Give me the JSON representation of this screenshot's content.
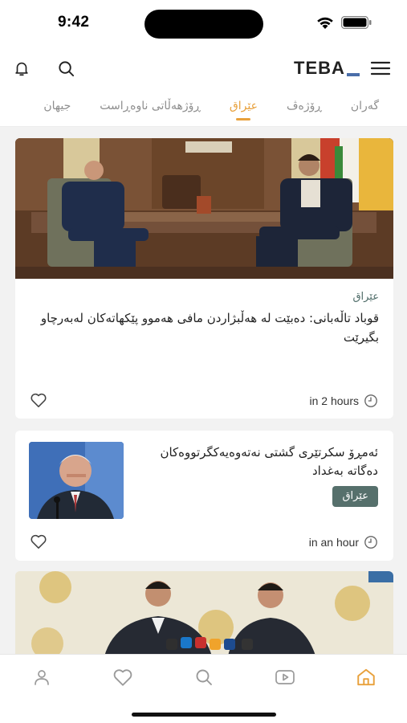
{
  "status": {
    "time": "9:42"
  },
  "header": {
    "logo_text": "TEBA",
    "bell_icon": "bell-icon",
    "search_icon": "search-icon",
    "menu_icon": "hamburger-menu-icon"
  },
  "tabs": [
    {
      "label": "گەران",
      "active": false
    },
    {
      "label": "ڕۆژەڤ",
      "active": false
    },
    {
      "label": "عێراق",
      "active": true
    },
    {
      "label": "ڕۆژهەڵاتی ناوەڕاست",
      "active": false
    },
    {
      "label": "جیهان",
      "active": false
    }
  ],
  "articles": [
    {
      "category": "عێراق",
      "title": "قوباد تاڵەبانی: دەبێت لە هەڵبژاردن مافی هەموو پێکهاتەکان لەبەرچاو بگیرێت",
      "time": "in 2 hours"
    },
    {
      "category": "عێراق",
      "title": "ئەمڕۆ سکرتێری گشتی نەتەوەیەکگرتووەکان دەگاتە بەغداد",
      "time": "in an hour"
    }
  ],
  "bottom_nav": [
    {
      "name": "profile",
      "icon": "user-icon"
    },
    {
      "name": "favorites",
      "icon": "heart-icon"
    },
    {
      "name": "search",
      "icon": "search-icon"
    },
    {
      "name": "video",
      "icon": "video-play-icon"
    },
    {
      "name": "home",
      "icon": "home-icon",
      "active": true
    }
  ],
  "colors": {
    "accent": "#e8a13c",
    "badge": "#56706c",
    "category_text": "#4d6b67",
    "inactive_icon": "#9a9a9a"
  }
}
